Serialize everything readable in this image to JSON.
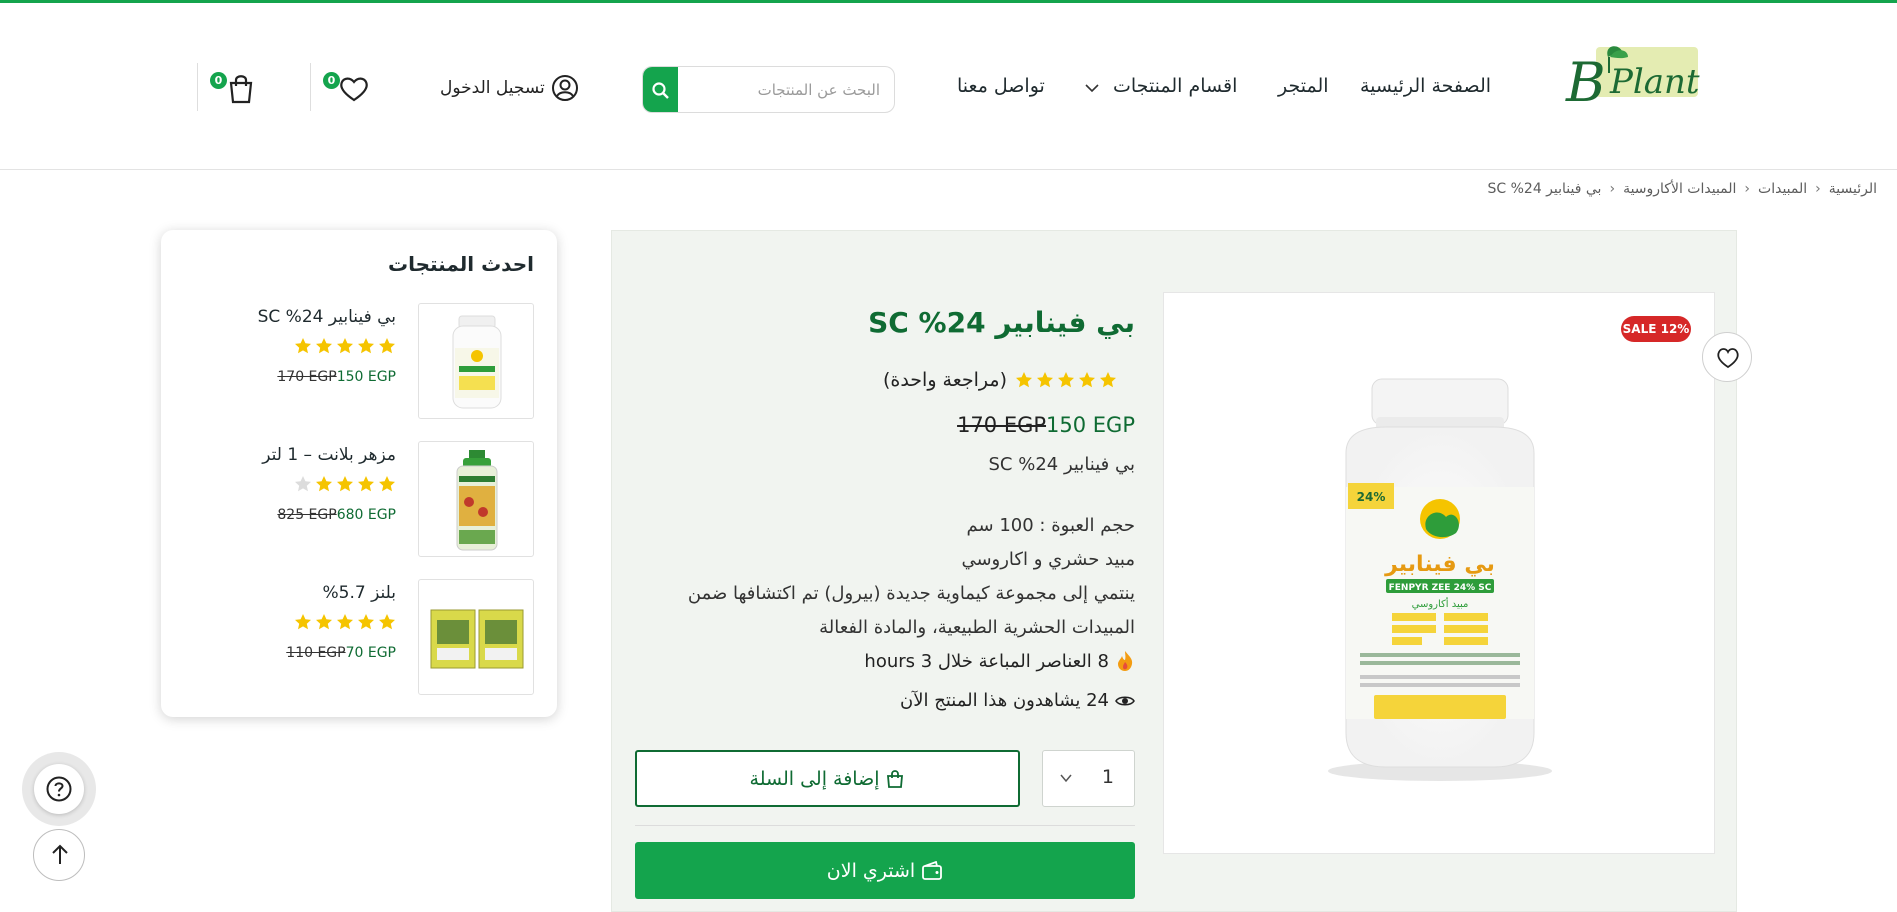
{
  "colors": {
    "brand_green": "#14a44d",
    "dark_green": "#0f6b33",
    "sale_red": "#d62828",
    "star_yellow": "#f5c400",
    "panel_bg": "#f1f4f0"
  },
  "header": {
    "logo_text": "BPlant",
    "nav": [
      {
        "label": "الصفحة الرئيسية"
      },
      {
        "label": "المتجر"
      },
      {
        "label": "اقسام المنتجات",
        "has_dropdown": true
      },
      {
        "label": "تواصل معنا"
      }
    ],
    "search": {
      "placeholder": "البحث عن المنتجات",
      "value": ""
    },
    "login_label": "تسجيل الدخول",
    "wishlist_count": "0",
    "cart_count": "0"
  },
  "breadcrumb": [
    "الرئيسية",
    "المبيدات",
    "المبيدات الأكاروسية",
    "بي فينابير 24% SC"
  ],
  "sidebar": {
    "title": "احدث المنتجات",
    "products": [
      {
        "name": "بي فينابير 24% SC",
        "rating": 5,
        "old_price": "170 EGP",
        "price": "150 EGP"
      },
      {
        "name": "مزهر بلانت – 1 لتر",
        "rating": 4,
        "old_price": "825 EGP",
        "price": "680 EGP"
      },
      {
        "name": "بلنز 5.7%",
        "rating": 5,
        "old_price": "110 EGP",
        "price": "70 EGP"
      }
    ]
  },
  "product": {
    "sale_badge": "SALE 12%",
    "title": "بي فينابير 24% SC",
    "rating": 5,
    "reviews_label": "(مراجعة واحدة)",
    "old_price": "170 EGP",
    "price": "150 EGP",
    "subtitle": "بي فينابير 24% SC",
    "description": [
      "حجم العبوة : 100 سم",
      "مبيد حشري و اكاروسي",
      "ينتمي إلى مجموعة كيماوية جديدة (بيرول) تم اكتشافها ضمن المبيدات الحشرية الطبيعية، والمادة الفعالة"
    ],
    "sold_text": "8 العناصر المباعة خلال 3 hours",
    "watching_text": "24 يشاهدون هذا المنتج الآن",
    "quantity": "1",
    "add_to_cart_label": "إضافة إلى السلة",
    "buy_now_label": "اشتري الان",
    "bottle_label": {
      "name": "بي فينابير",
      "sub": "FENPYR ZEE 24% SC",
      "type": "مبيد أكاروسي",
      "percent": "24%"
    }
  }
}
